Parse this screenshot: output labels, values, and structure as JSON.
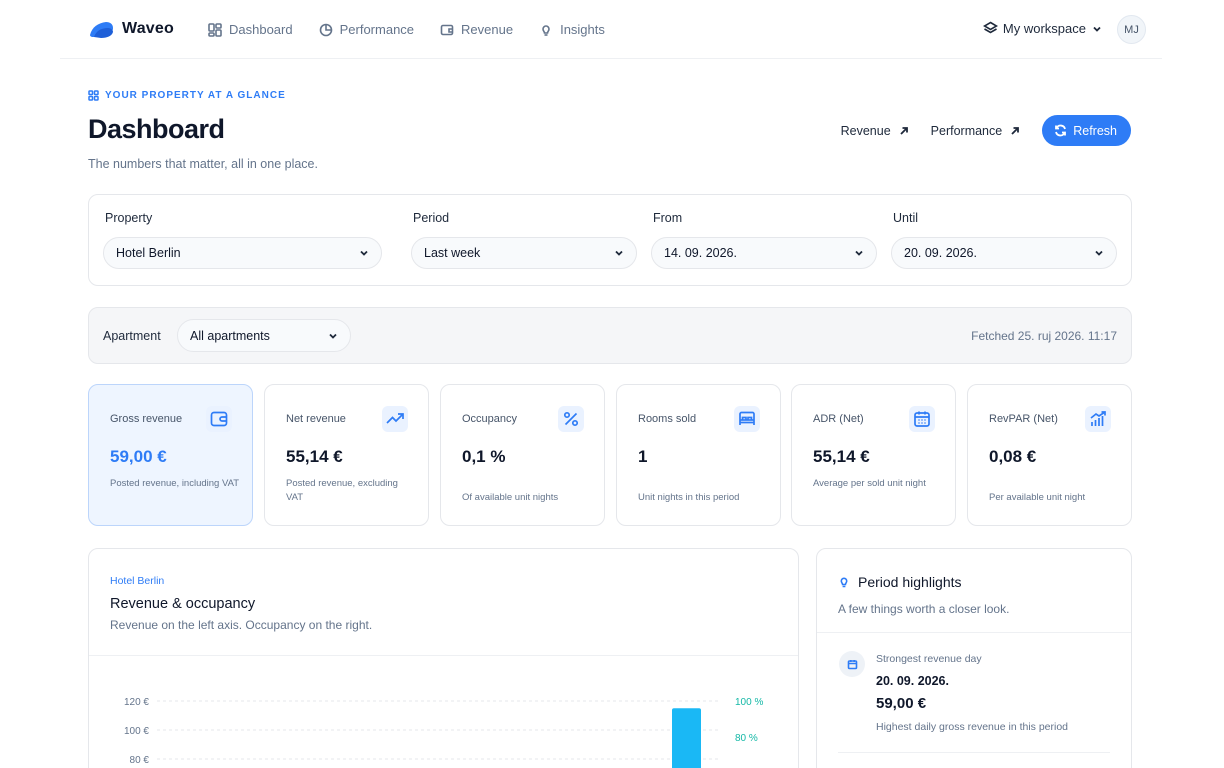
{
  "app": {
    "brand": "Waveo",
    "nav": [
      "Dashboard",
      "Performance",
      "Revenue",
      "Insights"
    ],
    "workspace": "My workspace",
    "avatar_initials": "MJ"
  },
  "header": {
    "eyebrow": "YOUR PROPERTY AT A GLANCE",
    "title": "Dashboard",
    "subtitle": "The numbers that matter, all in one place.",
    "links": [
      "Revenue",
      "Performance"
    ],
    "refresh_label": "Refresh"
  },
  "filters": {
    "property": {
      "label": "Property",
      "value": "Hotel Berlin"
    },
    "period": {
      "label": "Period",
      "value": "Last week"
    },
    "from": {
      "label": "From",
      "value": "14. 09. 2026."
    },
    "until": {
      "label": "Until",
      "value": "20. 09. 2026."
    }
  },
  "apartment": {
    "label": "Apartment",
    "value": "All apartments",
    "fetched": "Fetched 25. ruj 2026. 11:17"
  },
  "kpis": [
    {
      "label": "Gross revenue",
      "value": "59,00 €",
      "note": "Posted revenue, including VAT",
      "icon": "wallet-icon"
    },
    {
      "label": "Net revenue",
      "value": "55,14 €",
      "note": "Posted revenue, excluding VAT",
      "icon": "trending-up-icon"
    },
    {
      "label": "Occupancy",
      "value": "0,1 %",
      "note": "Of available unit nights",
      "icon": "percent-icon"
    },
    {
      "label": "Rooms sold",
      "value": "1",
      "note": "Unit nights in this period",
      "icon": "bed-icon"
    },
    {
      "label": "ADR (Net)",
      "value": "55,14 €",
      "note": "Average per sold unit night",
      "icon": "calendar-icon"
    },
    {
      "label": "RevPAR (Net)",
      "value": "0,08 €",
      "note": "Per available unit night",
      "icon": "bar-chart-icon"
    }
  ],
  "chart": {
    "eyebrow": "Hotel Berlin",
    "title": "Revenue & occupancy",
    "subtitle": "Revenue on the left axis. Occupancy on the right."
  },
  "chart_data": {
    "type": "bar",
    "title": "Revenue & occupancy",
    "left_ticks": [
      "120 €",
      "100 €",
      "80 €"
    ],
    "right_ticks": [
      "100 %",
      "80 %"
    ],
    "left_axis_range": [
      0,
      120
    ],
    "right_axis_range": [
      0,
      100
    ],
    "series": [
      {
        "name": "",
        "axis": "left",
        "visible_bar_top_value": 115
      }
    ],
    "grid": true,
    "colors": {
      "bar": "#1ab8f5",
      "right_axis": "#14b8a6"
    }
  },
  "highlights": {
    "title": "Period highlights",
    "subtitle": "A few things worth a closer look.",
    "items": [
      {
        "label": "Strongest revenue day",
        "date": "20. 09. 2026.",
        "value": "59,00 €",
        "note": "Highest daily gross revenue in this period"
      }
    ]
  },
  "colors": {
    "accent": "#2e7cf6",
    "text": "#0f172a",
    "muted": "#64748b"
  }
}
